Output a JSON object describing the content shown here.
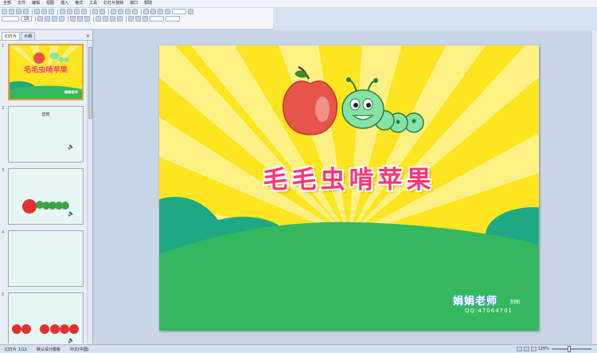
{
  "menubar": {
    "items": [
      "全部",
      "文件",
      "编辑",
      "视图",
      "插入",
      "格式",
      "工具",
      "幻灯片放映",
      "窗口",
      "帮助"
    ]
  },
  "toolbar": {
    "font_size": "18"
  },
  "side_panel": {
    "tabs": [
      "幻灯片",
      "大纲"
    ],
    "close_icon": "close-icon",
    "slides": [
      {
        "number": "1",
        "title": "毛毛虫啃苹果",
        "logo": "娟娟老师"
      },
      {
        "number": "2",
        "title": "音效",
        "has_audio": true
      },
      {
        "number": "3",
        "has_audio": true
      },
      {
        "number": "4"
      },
      {
        "number": "5",
        "has_audio": true
      }
    ]
  },
  "slide": {
    "title": "毛毛虫啃苹果",
    "brand": "娟娟老师",
    "brand_sub": "制图",
    "qq": "QQ:47064701",
    "colors": {
      "background": "#fde51f",
      "rays": "#fff6a6",
      "grass": "#34b85e",
      "hill": "#1fa884",
      "title": "#ff3574"
    }
  },
  "statusbar": {
    "slide_info": "幻灯片 1/12",
    "design": "默认设计模板",
    "language": "中文(中国)",
    "zoom": "125%"
  }
}
